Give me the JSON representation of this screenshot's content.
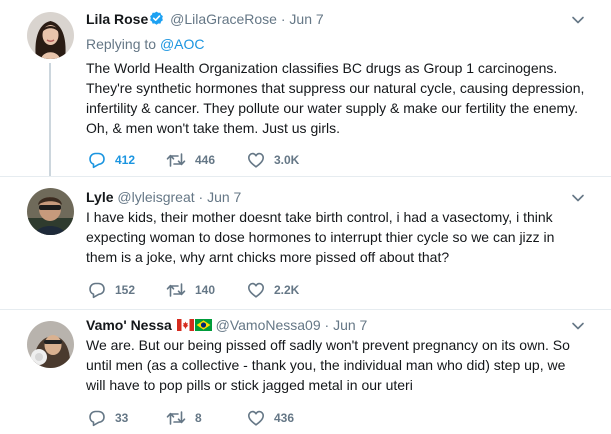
{
  "tweets": [
    {
      "name": "Lila Rose",
      "handle": "@LilaGraceRose",
      "dot": "·",
      "time": "Jun 7",
      "verified": true,
      "replying_prefix": "Replying to",
      "replying_to": "@AOC",
      "lines": [
        "The World Health Organization classifies BC drugs as Group 1 carcinogens.",
        "They're synthetic hormones that suppress our natural cycle, causing depression,",
        "infertility & cancer. They pollute our water supply & make our fertility the enemy.",
        "Oh, & men won't take them. Just us girls."
      ],
      "replies": "412",
      "retweets": "446",
      "likes": "3.0K"
    },
    {
      "name": "Lyle",
      "handle": "@lyleisgreat",
      "dot": "·",
      "time": "Jun 7",
      "lines": [
        "I have kids, their mother doesnt take birth control, i had a vasectomy, i think",
        "expecting woman to dose hormones to interrupt thier cycle so we can jizz in",
        "them is a joke, why arnt chicks more pissed off about that?"
      ],
      "replies": "152",
      "retweets": "140",
      "likes": "2.2K"
    },
    {
      "name": "Vamo' Nessa",
      "handle": "@VamoNessa09",
      "dot": "·",
      "time": "Jun 7",
      "flags": [
        "canada-flag-icon",
        "brazil-flag-icon"
      ],
      "lines": [
        "We are. But our being pissed off sadly won't prevent pregnancy on its own. So",
        "until men (as a collective - thank you, the individual man who did) step up, we",
        "will have to pop pills or stick jagged metal in our uteri"
      ],
      "replies": "33",
      "retweets": "8",
      "likes": "436"
    }
  ],
  "colors": {
    "text": "#14171a",
    "secondary": "#657786",
    "link": "#1b95e0",
    "divider": "#e6ecf0",
    "thread_line": "#ccd6dd",
    "verified": "#1da1f2"
  },
  "icons": [
    "verified-badge-icon",
    "reply-icon",
    "retweet-icon",
    "like-icon",
    "chevron-down-icon"
  ]
}
